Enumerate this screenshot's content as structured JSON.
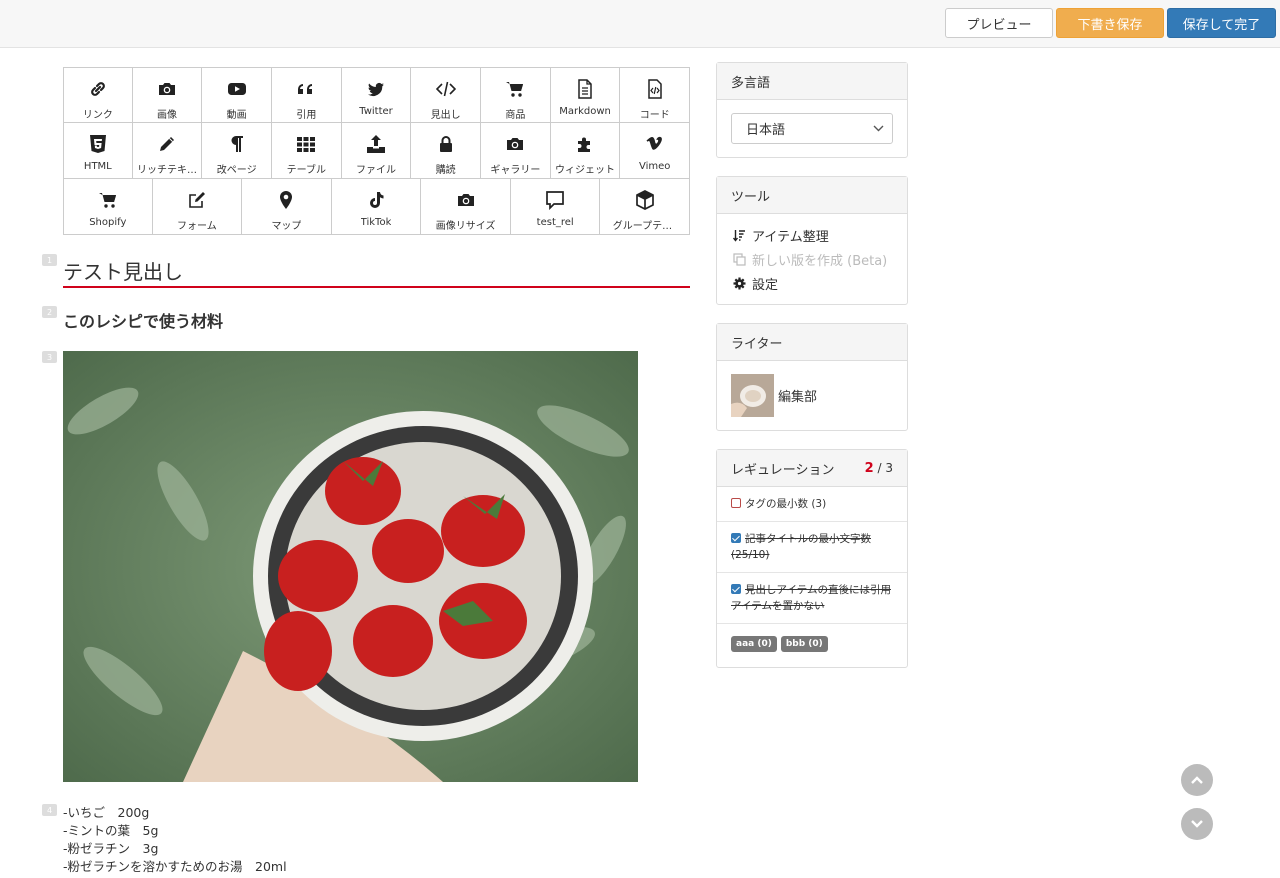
{
  "topbar": {
    "preview_label": "プレビュー",
    "draft_label": "下書き保存",
    "save_label": "保存して完了"
  },
  "toolbar": {
    "row1": [
      "リンク",
      "画像",
      "動画",
      "引用",
      "Twitter",
      "見出し",
      "商品",
      "Markdown",
      "コード"
    ],
    "row2": [
      "HTML",
      "リッチテキ…",
      "改ページ",
      "テーブル",
      "ファイル",
      "購読",
      "ギャラリー",
      "ウィジェット",
      "Vimeo"
    ],
    "row3": [
      "Shopify",
      "フォーム",
      "マップ",
      "TikTok",
      "画像リサイズ",
      "test_rel",
      "グループテスト"
    ]
  },
  "units": {
    "n1": "1",
    "n2": "2",
    "n3": "3",
    "n4": "4",
    "heading1": "テスト見出し",
    "heading2": "このレシピで使う材料",
    "ingredients": [
      "-いちご　200g",
      "-ミントの葉　5g",
      "-粉ゼラチン　3g",
      "-粉ゼラチンを溶かすためのお湯　20ml"
    ]
  },
  "panels": {
    "lang_title": "多言語",
    "lang_selected": "日本語",
    "tools_title": "ツール",
    "tool_organize": "アイテム整理",
    "tool_new_version": "新しい版を作成 (Beta)",
    "tool_settings": "設定",
    "writer_title": "ライター",
    "writer_name": "編集部",
    "reg_title": "レギュレーション",
    "reg_current": "2",
    "reg_total": "/ 3",
    "reg_items": [
      "タグの最小数 (3)",
      "記事タイトルの最小文字数 (25/10)",
      "見出しアイテムの直後には引用アイテムを置かない"
    ],
    "tags": [
      "aaa (0)",
      "bbb (0)"
    ]
  },
  "colors": {
    "accent_red": "#d0021b",
    "draft": "#f0ad4e",
    "primary": "#337ab7"
  }
}
